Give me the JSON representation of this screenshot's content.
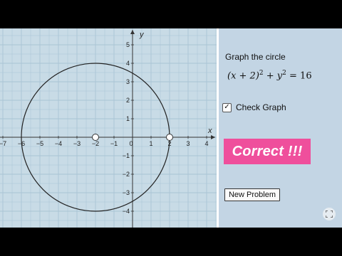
{
  "graph": {
    "x_ticks": [
      "−7",
      "−6",
      "−5",
      "−4",
      "−3",
      "−2",
      "−1",
      "0",
      "1",
      "2",
      "3",
      "4"
    ],
    "y_ticks": [
      "5",
      "4",
      "3",
      "2",
      "1",
      "−1",
      "−2",
      "−3",
      "−4"
    ],
    "x_axis_label": "x",
    "y_axis_label": "y",
    "circle": {
      "center_x": -2,
      "center_y": 0,
      "radius": 4
    },
    "points": [
      {
        "x": -2,
        "y": 0
      },
      {
        "x": 2,
        "y": 0
      }
    ],
    "colors": {
      "grid": "#a9c4d4",
      "axis": "#333333",
      "circle": "#222222",
      "background": "#c8dbe6"
    }
  },
  "side": {
    "prompt": "Graph the circle",
    "equation": {
      "left_paren": "(x + 2)",
      "exp1": "2",
      "plus": " + y",
      "exp2": "2",
      "rhs": " = 16"
    },
    "check_label": "Check Graph",
    "check_mark": "✓",
    "correct_text": "Correct !!!",
    "new_problem_label": "New Problem",
    "accent": "#ef4f9c"
  }
}
